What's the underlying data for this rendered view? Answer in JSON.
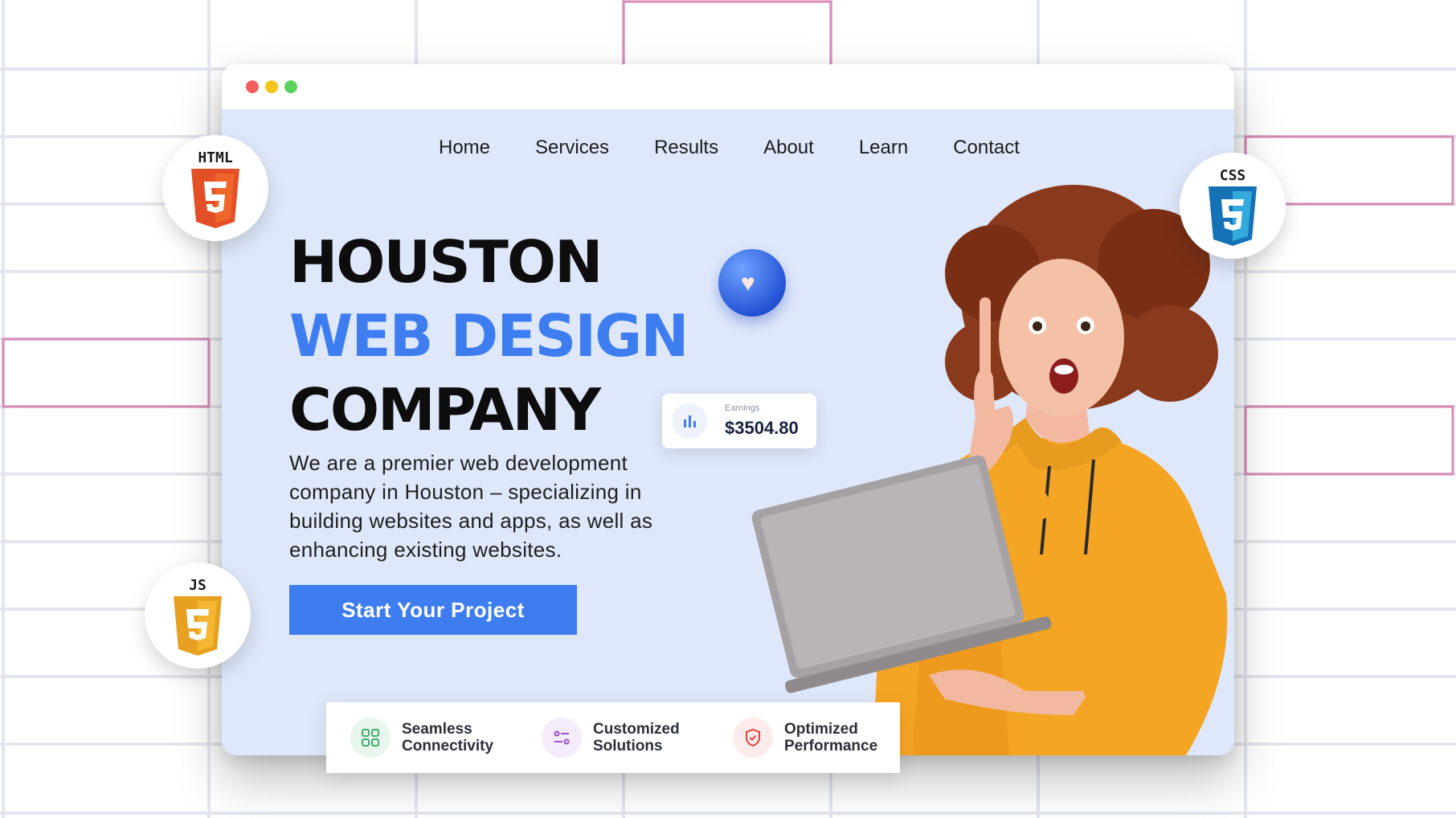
{
  "browser": {
    "window_controls": [
      "close",
      "minimize",
      "maximize"
    ]
  },
  "nav": {
    "items": [
      {
        "label": "Home"
      },
      {
        "label": "Services"
      },
      {
        "label": "Results"
      },
      {
        "label": "About"
      },
      {
        "label": "Learn"
      },
      {
        "label": "Contact"
      }
    ]
  },
  "hero": {
    "title_line1": "HOUSTON",
    "title_line2": "WEB DESIGN",
    "title_line3": "COMPANY",
    "description": "We are a premier web development company in Houston – specializing in building websites and apps, as well as enhancing existing websites.",
    "cta_label": "Start Your Project"
  },
  "earnings": {
    "label": "Earnings",
    "value": "$3504.80"
  },
  "features": [
    {
      "line1": "Seamless",
      "line2": "Connectivity",
      "icon": "grid-icon",
      "color": "#3fae6a"
    },
    {
      "line1": "Customized",
      "line2": "Solutions",
      "icon": "sliders-icon",
      "color": "#9b4fd1"
    },
    {
      "line1": "Optimized",
      "line2": "Performance",
      "icon": "shield-icon",
      "color": "#e0413e"
    }
  ],
  "badges": {
    "html": "HTML",
    "css": "CSS",
    "js": "JS"
  },
  "colors": {
    "accent": "#3e7df0",
    "page_bg": "#dfe8fb",
    "hoodie": "#f5a524"
  }
}
